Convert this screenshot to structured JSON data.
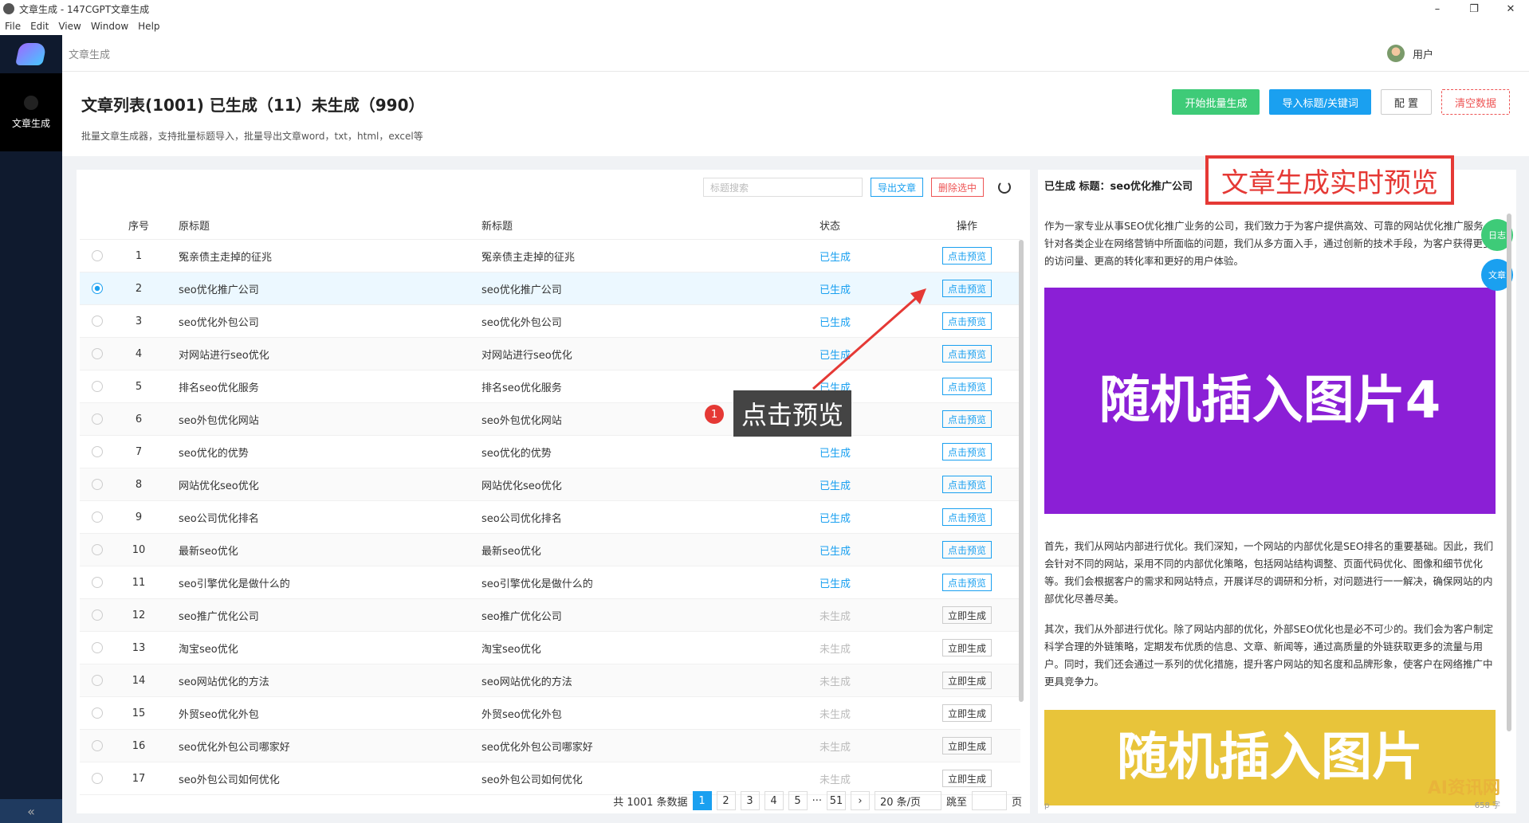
{
  "window": {
    "title": "文章生成 - 147CGPT文章生成",
    "minimize": "–",
    "restore": "❐",
    "close": "✕"
  },
  "menu": [
    "File",
    "Edit",
    "View",
    "Window",
    "Help"
  ],
  "sidebar": {
    "logo_icon": "app-logo-icon",
    "nav_label": "文章生成",
    "collapse": "«"
  },
  "topbar": {
    "breadcrumb": "文章生成",
    "user": "用户"
  },
  "header": {
    "title": "文章列表(1001) 已生成（11）未生成（990）",
    "description": "批量文章生成器，支持批量标题导入，批量导出文章word，txt，html，excel等",
    "actions": {
      "batch": "开始批量生成",
      "import": "导入标题/关键词",
      "config": "配 置",
      "clear": "清空数据"
    }
  },
  "toolbar": {
    "search_placeholder": "标题搜索",
    "export": "导出文章",
    "delete": "删除选中"
  },
  "table": {
    "headers": {
      "no": "序号",
      "orig": "原标题",
      "new": "新标题",
      "status": "状态",
      "op": "操作"
    },
    "rows": [
      {
        "no": "1",
        "orig": "冤亲债主走掉的征兆",
        "new": "冤亲债主走掉的征兆",
        "status": "已生成",
        "op": "点击预览",
        "done": true,
        "selected": false
      },
      {
        "no": "2",
        "orig": "seo优化推广公司",
        "new": "seo优化推广公司",
        "status": "已生成",
        "op": "点击预览",
        "done": true,
        "selected": true
      },
      {
        "no": "3",
        "orig": "seo优化外包公司",
        "new": "seo优化外包公司",
        "status": "已生成",
        "op": "点击预览",
        "done": true,
        "selected": false
      },
      {
        "no": "4",
        "orig": "对网站进行seo优化",
        "new": "对网站进行seo优化",
        "status": "已生成",
        "op": "点击预览",
        "done": true,
        "selected": false
      },
      {
        "no": "5",
        "orig": "排名seo优化服务",
        "new": "排名seo优化服务",
        "status": "已生成",
        "op": "点击预览",
        "done": true,
        "selected": false
      },
      {
        "no": "6",
        "orig": "seo外包优化网站",
        "new": "seo外包优化网站",
        "status": "已生成",
        "op": "点击预览",
        "done": true,
        "selected": false
      },
      {
        "no": "7",
        "orig": "seo优化的优势",
        "new": "seo优化的优势",
        "status": "已生成",
        "op": "点击预览",
        "done": true,
        "selected": false
      },
      {
        "no": "8",
        "orig": "网站优化seo优化",
        "new": "网站优化seo优化",
        "status": "已生成",
        "op": "点击预览",
        "done": true,
        "selected": false
      },
      {
        "no": "9",
        "orig": "seo公司优化排名",
        "new": "seo公司优化排名",
        "status": "已生成",
        "op": "点击预览",
        "done": true,
        "selected": false
      },
      {
        "no": "10",
        "orig": "最新seo优化",
        "new": "最新seo优化",
        "status": "已生成",
        "op": "点击预览",
        "done": true,
        "selected": false
      },
      {
        "no": "11",
        "orig": "seo引擎优化是做什么的",
        "new": "seo引擎优化是做什么的",
        "status": "已生成",
        "op": "点击预览",
        "done": true,
        "selected": false
      },
      {
        "no": "12",
        "orig": "seo推广优化公司",
        "new": "seo推广优化公司",
        "status": "未生成",
        "op": "立即生成",
        "done": false,
        "selected": false
      },
      {
        "no": "13",
        "orig": "淘宝seo优化",
        "new": "淘宝seo优化",
        "status": "未生成",
        "op": "立即生成",
        "done": false,
        "selected": false
      },
      {
        "no": "14",
        "orig": "seo网站优化的方法",
        "new": "seo网站优化的方法",
        "status": "未生成",
        "op": "立即生成",
        "done": false,
        "selected": false
      },
      {
        "no": "15",
        "orig": "外贸seo优化外包",
        "new": "外贸seo优化外包",
        "status": "未生成",
        "op": "立即生成",
        "done": false,
        "selected": false
      },
      {
        "no": "16",
        "orig": "seo优化外包公司哪家好",
        "new": "seo优化外包公司哪家好",
        "status": "未生成",
        "op": "立即生成",
        "done": false,
        "selected": false
      },
      {
        "no": "17",
        "orig": "seo外包公司如何优化",
        "new": "seo外包公司如何优化",
        "status": "未生成",
        "op": "立即生成",
        "done": false,
        "selected": false
      }
    ]
  },
  "pagination": {
    "total": "共 1001 条数据",
    "pages": [
      "1",
      "2",
      "3",
      "4",
      "5",
      "···",
      "51"
    ],
    "next": "›",
    "size": "20 条/页",
    "jump": "跳至",
    "page_unit": "页"
  },
  "preview": {
    "head": "已生成 标题：seo优化推广公司",
    "callout": "文章生成实时预览",
    "p1": "作为一家专业从事SEO优化推广业务的公司，我们致力于为客户提供高效、可靠的网站优化推广服务。针对各类企业在网络营销中所面临的问题，我们从多方面入手，通过创新的技术手段，为客户获得更多的访问量、更高的转化率和更好的用户体验。",
    "img1": "随机插入图片4",
    "p2": "首先，我们从网站内部进行优化。我们深知，一个网站的内部优化是SEO排名的重要基础。因此，我们会针对不同的网站，采用不同的内部优化策略，包括网站结构调整、页面代码优化、图像和细节优化等。我们会根据客户的需求和网站特点，开展详尽的调研和分析，对问题进行一一解决，确保网站的内部优化尽善尽美。",
    "p3": "其次，我们从外部进行优化。除了网站内部的优化，外部SEO优化也是必不可少的。我们会为客户制定科学合理的外链策略，定期发布优质的信息、文章、新闻等，通过高质量的外链获取更多的流量与用户。同时，我们还会通过一系列的优化措施，提升客户网站的知名度和品牌形象，使客户在网络推广中更具竞争力。",
    "img2": "随机插入图片",
    "fab_log": "日志",
    "fab_article": "文章",
    "foot": "p",
    "word_count": "658 字",
    "watermark": "AI资讯网"
  },
  "annotation": {
    "num": "1",
    "text": "点击预览"
  },
  "colors": {
    "accent": "#1aa0f0",
    "success": "#3ecb78",
    "danger": "#e53935",
    "purple": "#8b1fd6",
    "yellow": "#e8c43a"
  }
}
